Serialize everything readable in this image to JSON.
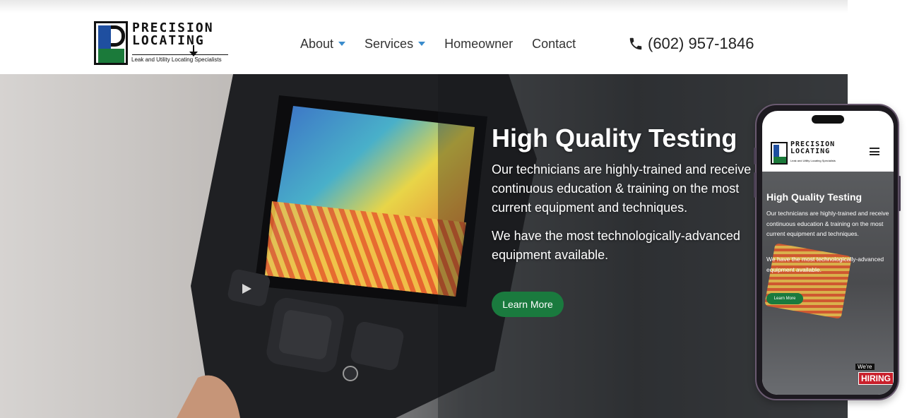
{
  "brand": {
    "name_line1": "PRECISION",
    "name_line2": "LOCATING",
    "tagline": "Leak and Utility Locating Specialists"
  },
  "nav": {
    "items": [
      {
        "label": "About",
        "has_dropdown": true
      },
      {
        "label": "Services",
        "has_dropdown": true
      },
      {
        "label": "Homeowner",
        "has_dropdown": false
      },
      {
        "label": "Contact",
        "has_dropdown": false
      }
    ]
  },
  "header": {
    "phone": "(602) 957-1846"
  },
  "hero": {
    "title": "High Quality Testing",
    "paragraph1": "Our technicians are highly-trained and receive continuous education & training on the most current equipment and techniques.",
    "paragraph2": "We have the most technologically-advanced equipment available.",
    "cta_label": "Learn More"
  },
  "mobile": {
    "badge_line1": "We're",
    "badge_line2": "HIRING"
  },
  "colors": {
    "accent_green": "#1a7a3e",
    "nav_caret_blue": "#3a8ccc",
    "logo_blue": "#1f4fa0",
    "logo_green": "#1b7a3a",
    "hiring_red": "#c91f2b"
  },
  "icons": {
    "phone": "phone-icon",
    "menu": "hamburger-menu-icon",
    "dropdown": "chevron-down-icon"
  }
}
